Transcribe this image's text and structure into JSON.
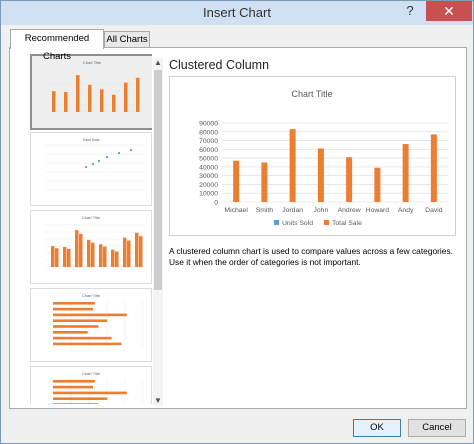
{
  "window": {
    "title": "Insert Chart",
    "help_glyph": "?",
    "close_glyph": "✕"
  },
  "tabs": [
    {
      "label": "Recommended Charts"
    },
    {
      "label": "All Charts"
    }
  ],
  "thumbnails": [
    {
      "title": "Chart Title",
      "type": "clustered-column"
    },
    {
      "title": "Total Sale",
      "type": "scatter"
    },
    {
      "title": "Chart Title",
      "type": "combo-column"
    },
    {
      "title": "Chart Title",
      "type": "clustered-bar"
    },
    {
      "title": "Chart Title",
      "type": "clustered-bar"
    }
  ],
  "selected": {
    "heading": "Clustered Column",
    "description": "A clustered column chart is used to compare values across a few categories. Use it when the order of categories is not important."
  },
  "chart_data": {
    "type": "bar",
    "title": "Chart Title",
    "categories": [
      "Michael",
      "Smith",
      "Jordan",
      "John",
      "Andrew",
      "Howard",
      "Andy",
      "David"
    ],
    "series": [
      {
        "name": "Units Sold",
        "values": [
          0,
          0,
          0,
          0,
          0,
          0,
          0,
          0
        ],
        "color": "#5b9bd5"
      },
      {
        "name": "Total Sale",
        "values": [
          47000,
          45000,
          83000,
          61000,
          51000,
          39000,
          66000,
          77000
        ],
        "color": "#ed7d31"
      }
    ],
    "ylim": [
      0,
      90000
    ],
    "yticks": [
      "0",
      "10000",
      "20000",
      "30000",
      "40000",
      "50000",
      "60000",
      "70000",
      "80000",
      "90000"
    ],
    "grid": true,
    "legend": "bottom"
  },
  "buttons": {
    "ok": "OK",
    "cancel": "Cancel"
  },
  "colors": {
    "accent": "#ed7d31",
    "secondary": "#5b9bd5",
    "titlebar": "#cfe0f3",
    "close": "#c75050"
  }
}
